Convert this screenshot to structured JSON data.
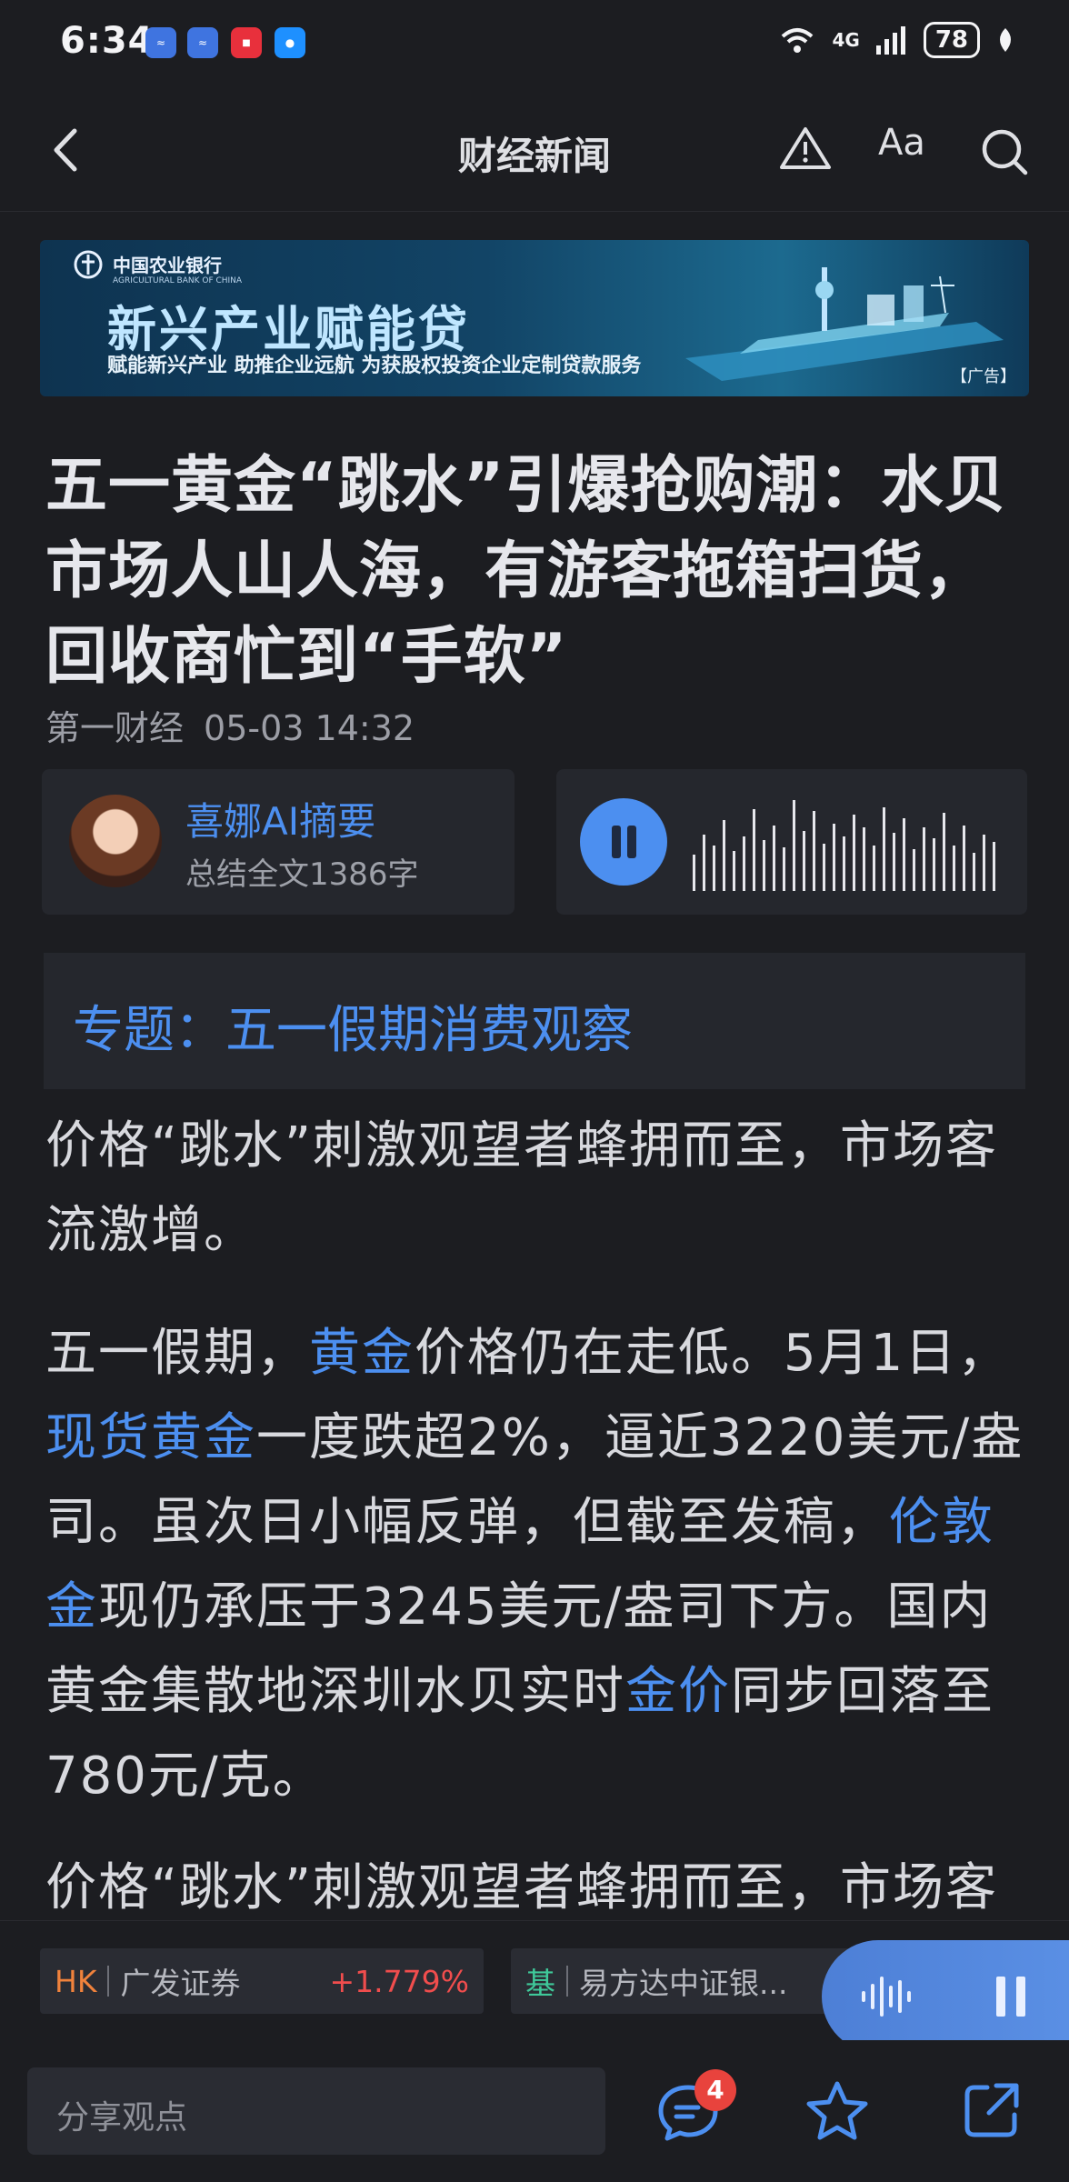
{
  "status_bar": {
    "time": "6:34",
    "network": "4G",
    "battery": "78"
  },
  "nav": {
    "title": "财经新闻",
    "font_button": "Aa"
  },
  "ad": {
    "bank": "中国农业银行",
    "bank_en": "AGRICULTURAL BANK OF CHINA",
    "headline": "新兴产业赋能贷",
    "subtitle": "赋能新兴产业  助推企业远航  为获股权投资企业定制贷款服务",
    "tag": "【广告】"
  },
  "article": {
    "title": "五一黄金“跳水”引爆抢购潮：水贝市场人山人海，有游客拖箱扫货，回收商忙到“手软”",
    "source": "第一财经",
    "datetime": "05-03 14:32",
    "ai_summary": {
      "title": "喜娜AI摘要",
      "subtitle": "总结全文1386字"
    },
    "topic": "专题：五一假期消费观察",
    "para1": "价格“跳水”刺激观望者蜂拥而至，市场客流激增。",
    "para2": {
      "t1": "五一假期，",
      "l1": "黄金",
      "t2": "价格仍在走低。5月1日，",
      "l2": "现货黄金",
      "t3": "一度跌超2%，逼近3220美元/盎司。虽次日小幅反弹，但截至发稿，",
      "l3": "伦敦金",
      "t4": "现仍承压于3245美元/盎司下方。国内黄金集散地深圳水贝实时",
      "l4": "金价",
      "t5": "同步回落至780元/克。"
    },
    "para3": "价格“跳水”刺激观望者蜂拥而至，市场客流激增。"
  },
  "tickers": [
    {
      "code": "HK",
      "name": "广发证券",
      "change": "+1.779%",
      "code_color": "#f0823c"
    },
    {
      "code": "基",
      "name": "易方达中证银...",
      "code_color": "#3fc99a"
    }
  ],
  "bottom_bar": {
    "share_placeholder": "分享观点",
    "comment_count": "4"
  },
  "colors": {
    "accent": "#4c8ff0",
    "up": "#f04d4d",
    "background": "#1c1d21"
  }
}
